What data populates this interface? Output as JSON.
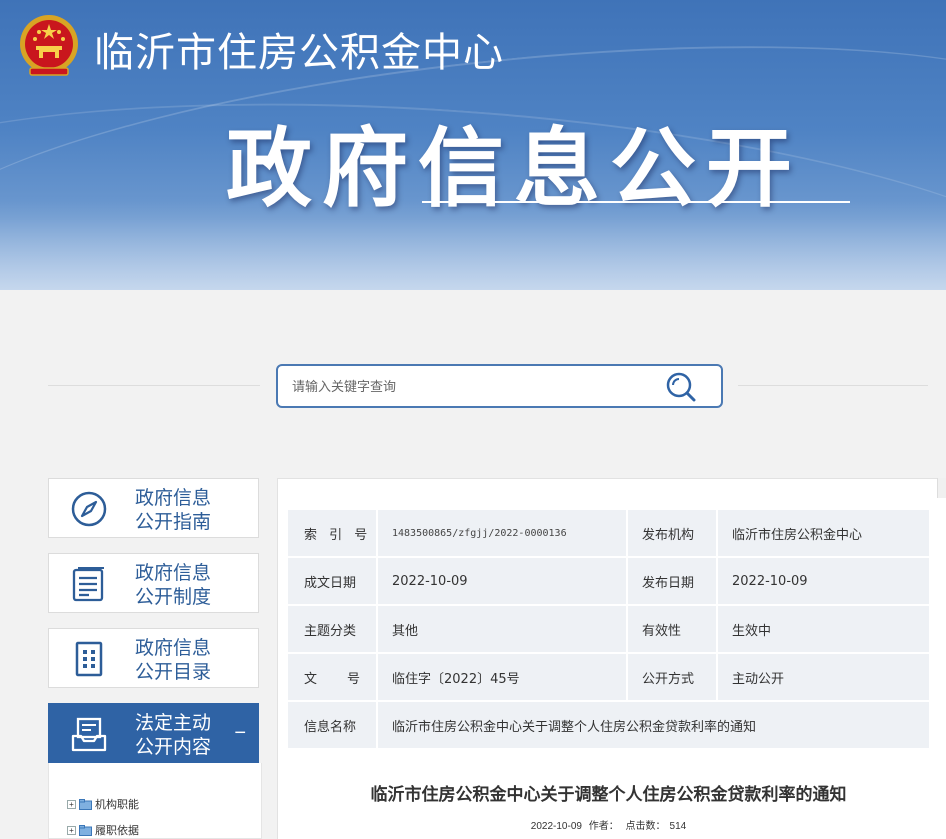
{
  "header": {
    "site_name": "临沂市住房公积金中心",
    "big_title": "政府信息公开",
    "emblem_icon": "national-emblem-icon"
  },
  "search": {
    "placeholder": "请输入关键字查询",
    "value": "",
    "icon": "search-icon"
  },
  "nav": {
    "items": [
      {
        "label": "政府信息\n公开指南",
        "icon": "compass-icon",
        "active": false
      },
      {
        "label": "政府信息\n公开制度",
        "icon": "list-document-icon",
        "active": false
      },
      {
        "label": "政府信息\n公开目录",
        "icon": "directory-grid-icon",
        "active": false
      },
      {
        "label": "法定主动\n公开内容",
        "icon": "inbox-document-icon",
        "active": true,
        "toggle": "−"
      }
    ],
    "tree": [
      {
        "label": "机构职能"
      },
      {
        "label": "履职依据"
      }
    ]
  },
  "meta_table": {
    "rows": [
      {
        "k1": "索 引 号",
        "v1": "1483500865/zfgjj/2022-0000136",
        "k2": "发布机构",
        "v2": "临沂市住房公积金中心"
      },
      {
        "k1": "成文日期",
        "v1": "2022-10-09",
        "k2": "发布日期",
        "v2": "2022-10-09"
      },
      {
        "k1": "主题分类",
        "v1": "其他",
        "k2": "有效性",
        "v2": "生效中"
      },
      {
        "k1": "文",
        "k1b": "号",
        "v1": "临住字〔2022〕45号",
        "k2": "公开方式",
        "v2": "主动公开"
      }
    ],
    "name_row": {
      "k": "信息名称",
      "v": "临沂市住房公积金中心关于调整个人住房公积金贷款利率的通知"
    }
  },
  "article": {
    "title": "临沂市住房公积金中心关于调整个人住房公积金贷款利率的通知",
    "date": "2022-10-09",
    "author_label": "作者：",
    "hits_label": "点击数：",
    "hits": "514"
  },
  "colors": {
    "accent": "#2f63a5",
    "banner_top": "#3f73b8",
    "nav_text": "#2d5d98",
    "table_bg": "#eef1f5"
  }
}
